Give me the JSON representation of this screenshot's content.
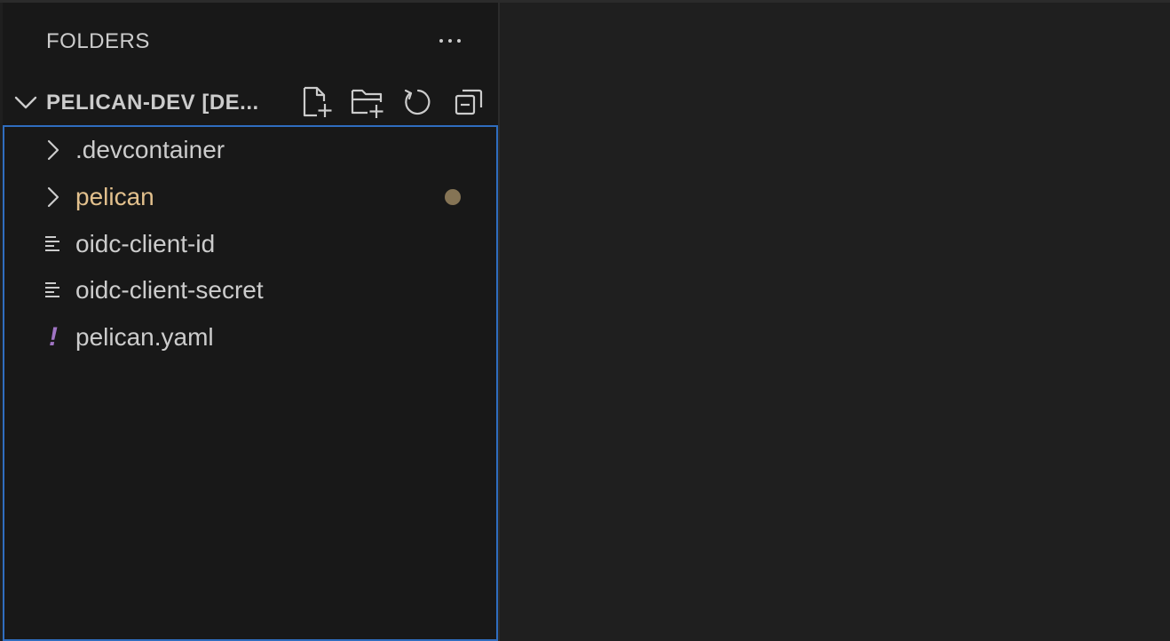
{
  "explorer": {
    "title": "FOLDERS",
    "more_actions": "···"
  },
  "workspace": {
    "title": "PELICAN-DEV [DE...",
    "actions": [
      {
        "name": "new-file",
        "icon": "new-file-icon"
      },
      {
        "name": "new-folder",
        "icon": "new-folder-icon"
      },
      {
        "name": "refresh",
        "icon": "refresh-icon"
      },
      {
        "name": "collapse-all",
        "icon": "collapse-all-icon"
      }
    ]
  },
  "tree": {
    "items": [
      {
        "label": ".devcontainer",
        "type": "folder",
        "icon": "chevron-right-icon"
      },
      {
        "label": "pelican",
        "type": "folder",
        "icon": "chevron-right-icon",
        "modified": true
      },
      {
        "label": "oidc-client-id",
        "type": "file",
        "icon": "text-file-icon"
      },
      {
        "label": "oidc-client-secret",
        "type": "file",
        "icon": "text-file-icon"
      },
      {
        "label": "pelican.yaml",
        "type": "file",
        "icon": "yaml-file-icon",
        "icon_glyph": "!"
      }
    ]
  },
  "colors": {
    "sidebar_bg": "#181818",
    "editor_bg": "#1f1f1f",
    "focus_border": "#2f6dbf",
    "modified_text": "#e2c08d",
    "modified_dot": "#857455",
    "yaml_icon": "#a074c4"
  }
}
